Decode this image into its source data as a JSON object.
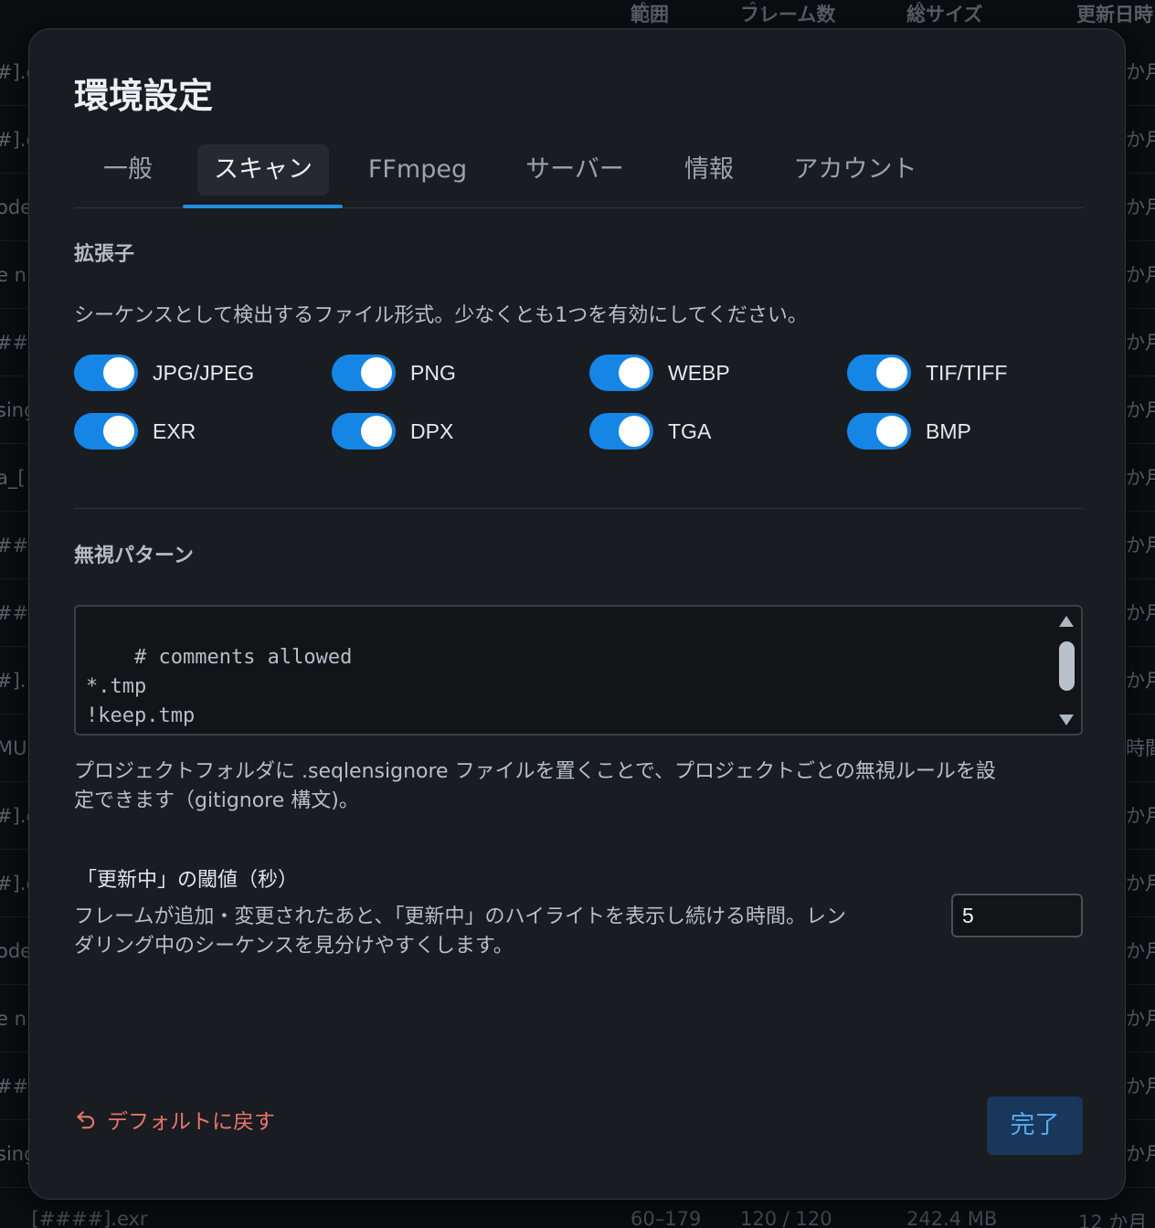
{
  "background": {
    "columns": [
      {
        "label": "範囲",
        "sort": "⌃⌄"
      },
      {
        "label": "フレーム数",
        "sort": "⌃⌄"
      },
      {
        "label": "総サイズ",
        "sort": "⌃⌄"
      },
      {
        "label": "更新日時",
        "sort": ""
      }
    ],
    "left_rows": [
      "#].e",
      "#].e",
      "ode",
      "e n",
      "##].",
      "sing",
      "a_[",
      "###",
      "###",
      "#].",
      "MU",
      "#].e",
      "#].e",
      "ode",
      "e n",
      "##].",
      "sing"
    ],
    "right_rows": [
      "か月",
      "か月",
      "か月",
      "か月",
      "か月",
      "か月",
      "か月",
      "か月",
      "か月",
      "か月",
      "時間前",
      "か月",
      "か月",
      "か月",
      "か月",
      "か月",
      "か月"
    ],
    "footer": {
      "name": "_[####].exr",
      "range": "60–179",
      "frames": "120 / 120",
      "size": "242.4 MB",
      "updated": "12 か月"
    }
  },
  "modal": {
    "title": "環境設定",
    "tabs": [
      "一般",
      "スキャン",
      "FFmpeg",
      "サーバー",
      "情報",
      "アカウント"
    ],
    "active_tab": "スキャン",
    "extensions": {
      "heading": "拡張子",
      "description": "シーケンスとして検出するファイル形式。少なくとも1つを有効にしてください。",
      "items": [
        {
          "label": "JPG/JPEG",
          "enabled": true
        },
        {
          "label": "PNG",
          "enabled": true
        },
        {
          "label": "WEBP",
          "enabled": true
        },
        {
          "label": "TIF/TIFF",
          "enabled": true
        },
        {
          "label": "EXR",
          "enabled": true
        },
        {
          "label": "DPX",
          "enabled": true
        },
        {
          "label": "TGA",
          "enabled": true
        },
        {
          "label": "BMP",
          "enabled": true
        }
      ]
    },
    "ignore": {
      "heading": "無視パターン",
      "value": "# comments allowed\n*.tmp\n!keep.tmp\ncache/",
      "help_line1": "プロジェクトフォルダに .seqlensignore ファイルを置くことで、プロジェクトごとの無視ルールを設",
      "help_line2": "定できます（gitignore 構文)。"
    },
    "threshold": {
      "label": "「更新中」の閾値（秒）",
      "desc_line1": "フレームが追加・変更されたあと、「更新中」のハイライトを表示し続ける時間。レン",
      "desc_line2": "ダリング中のシーケンスを見分けやすくします。",
      "value": "5"
    },
    "reset_label": "デフォルトに戻す",
    "done_label": "完了"
  },
  "colors": {
    "accent": "#1585e6",
    "danger": "#e8756c",
    "modal_bg": "#191c20"
  }
}
